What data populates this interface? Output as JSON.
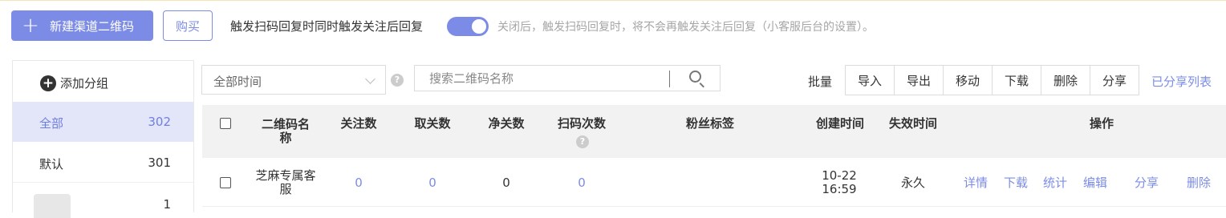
{
  "toolbar": {
    "new_qr_label": "新建渠道二维码",
    "buy_label": "购买",
    "toggle_label": "触发扫码回复时同时触发关注后回复",
    "toggle_on": true,
    "toggle_hint": "关闭后，触发扫码回复时，将不会再触发关注后回复（小客服后台的设置）。"
  },
  "sidebar": {
    "add_group_label": "添加分组",
    "groups": [
      {
        "name": "全部",
        "count": "302",
        "selected": true
      },
      {
        "name": "默认",
        "count": "301",
        "selected": false
      },
      {
        "name": "",
        "count": "1",
        "selected": false
      }
    ]
  },
  "filters": {
    "time_select_value": "全部时间",
    "search_placeholder": "搜索二维码名称"
  },
  "batch": {
    "label": "批量",
    "buttons": [
      "导入",
      "导出",
      "移动",
      "下载",
      "删除",
      "分享"
    ],
    "shared_list_link": "已分享列表"
  },
  "table": {
    "headers": {
      "name": "二维码名称",
      "follow": "关注数",
      "unfollow": "取关数",
      "net": "净关数",
      "scans": "扫码次数",
      "tags": "粉丝标签",
      "created": "创建时间",
      "expire": "失效时间",
      "actions": "操作"
    },
    "rows": [
      {
        "name": "芝麻专属客服",
        "follow": "0",
        "unfollow": "0",
        "net": "0",
        "scans": "0",
        "tags": "",
        "created": "10-22 16:59",
        "expire": "永久",
        "actions": [
          "详情",
          "下载",
          "统计",
          "编辑",
          "分享",
          "删除"
        ]
      }
    ]
  },
  "colors": {
    "accent": "#7c8ce6",
    "selected_bg": "#e3e6f8",
    "header_bg": "#f2f2f2"
  }
}
